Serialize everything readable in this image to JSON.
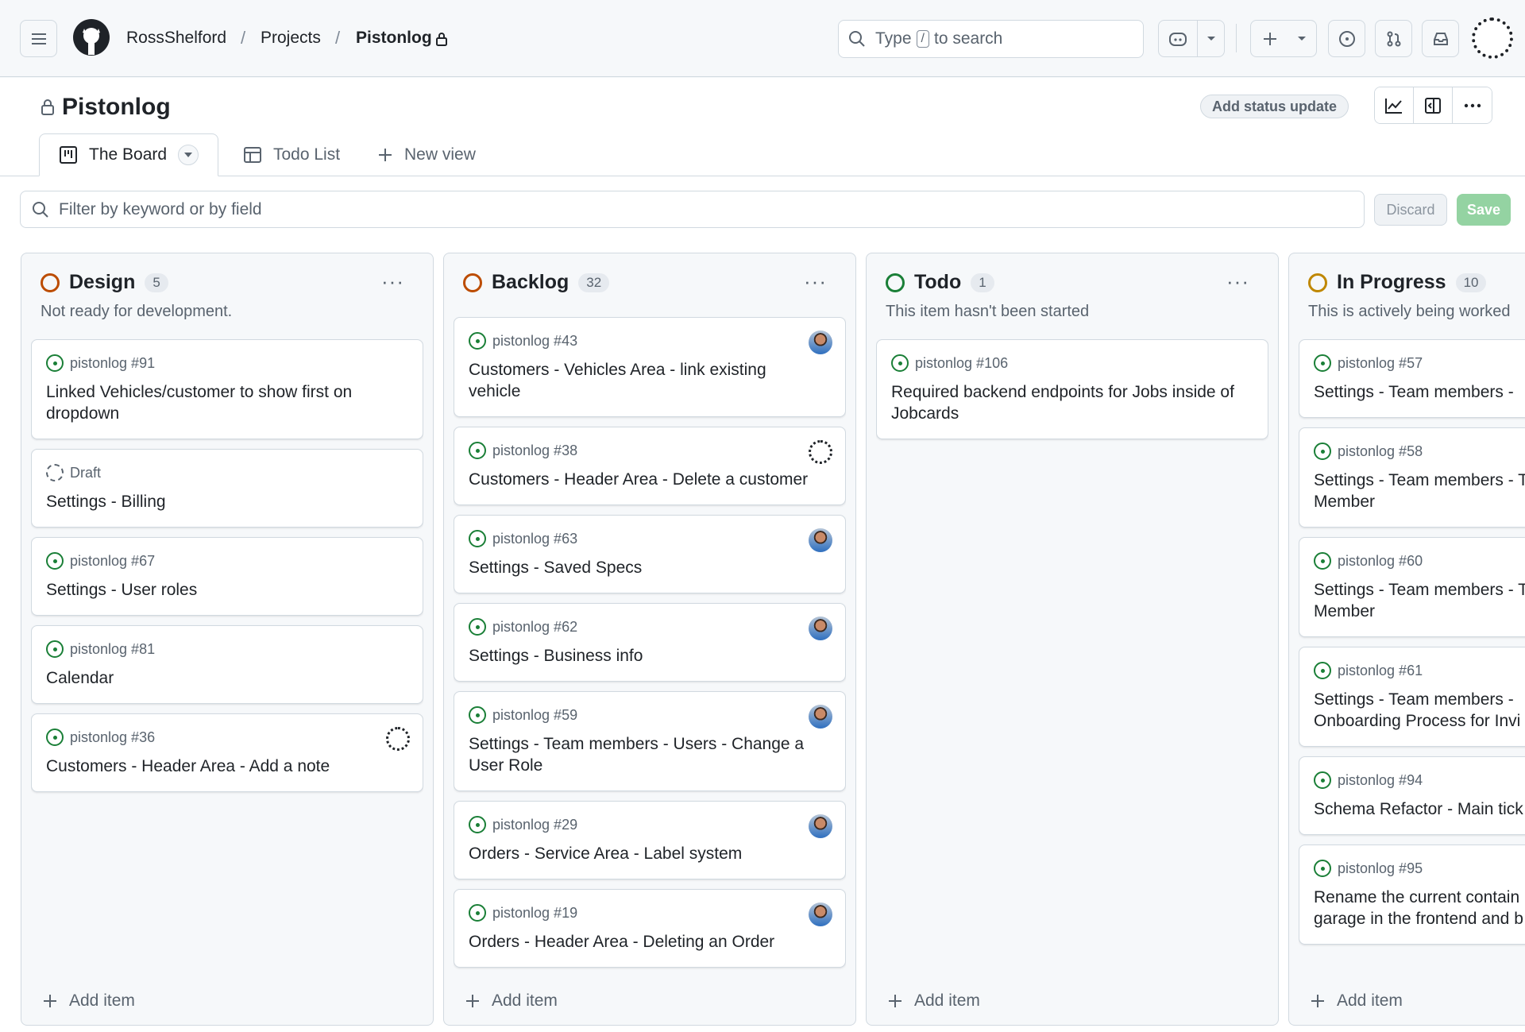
{
  "header": {
    "owner": "RossShelford",
    "projects": "Projects",
    "repo": "Pistonlog",
    "separator": "/",
    "search_prefix": "Type",
    "search_key": "/",
    "search_suffix": "to search"
  },
  "project": {
    "title": "Pistonlog",
    "status_button": "Add status update"
  },
  "tabs": [
    {
      "label": "The Board",
      "active": true
    },
    {
      "label": "Todo List",
      "active": false
    },
    {
      "label": "New view",
      "active": false
    }
  ],
  "filter": {
    "placeholder": "Filter by keyword or by field",
    "discard": "Discard",
    "save": "Save"
  },
  "colors": {
    "green": "#1a7f37",
    "orange": "#bc4c00",
    "yellow": "#bf8700",
    "save_disabled": "#94d3a2"
  },
  "columns": [
    {
      "name": "Design",
      "count": "5",
      "desc": "Not ready for development.",
      "ring": "#bc4c00",
      "add": "Add item",
      "cards": [
        {
          "meta": "pistonlog #91",
          "title": "Linked Vehicles/customer to show first on dropdown",
          "type": "issue",
          "avatar": ""
        },
        {
          "meta": "Draft",
          "title": "Settings - Billing",
          "type": "draft",
          "avatar": ""
        },
        {
          "meta": "pistonlog #67",
          "title": "Settings - User roles",
          "type": "issue",
          "avatar": ""
        },
        {
          "meta": "pistonlog #81",
          "title": "Calendar",
          "type": "issue",
          "avatar": ""
        },
        {
          "meta": "pistonlog #36",
          "title": "Customers - Header Area - Add a note",
          "type": "issue",
          "avatar": "logo"
        }
      ]
    },
    {
      "name": "Backlog",
      "count": "32",
      "desc": "",
      "ring": "#bc4c00",
      "add": "Add item",
      "cards": [
        {
          "meta": "pistonlog #43",
          "title": "Customers - Vehicles Area - link existing vehicle",
          "type": "issue",
          "avatar": "photo"
        },
        {
          "meta": "pistonlog #38",
          "title": "Customers - Header Area - Delete a customer",
          "type": "issue",
          "avatar": "logo"
        },
        {
          "meta": "pistonlog #63",
          "title": "Settings - Saved Specs",
          "type": "issue",
          "avatar": "photo"
        },
        {
          "meta": "pistonlog #62",
          "title": "Settings - Business info",
          "type": "issue",
          "avatar": "photo"
        },
        {
          "meta": "pistonlog #59",
          "title": "Settings - Team members - Users - Change a User Role",
          "type": "issue",
          "avatar": "photo"
        },
        {
          "meta": "pistonlog #29",
          "title": "Orders - Service Area - Label system",
          "type": "issue",
          "avatar": "photo"
        },
        {
          "meta": "pistonlog #19",
          "title": "Orders - Header Area - Deleting an Order",
          "type": "issue",
          "avatar": "photo"
        }
      ]
    },
    {
      "name": "Todo",
      "count": "1",
      "desc": "This item hasn't been started",
      "ring": "#1a7f37",
      "add": "Add item",
      "cards": [
        {
          "meta": "pistonlog #106",
          "title": "Required backend endpoints for Jobs inside of Jobcards",
          "type": "issue",
          "avatar": ""
        }
      ]
    },
    {
      "name": "In Progress",
      "count": "10",
      "desc": "This is actively being worked",
      "ring": "#bf8700",
      "add": "Add item",
      "cards": [
        {
          "meta": "pistonlog #57",
          "title": "Settings - Team members -",
          "type": "issue",
          "avatar": ""
        },
        {
          "meta": "pistonlog #58",
          "title": "Settings - Team members - Team Member",
          "type": "issue",
          "avatar": ""
        },
        {
          "meta": "pistonlog #60",
          "title": "Settings - Team members - Team Member",
          "type": "issue",
          "avatar": ""
        },
        {
          "meta": "pistonlog #61",
          "title": "Settings - Team members - Onboarding Process for Invi",
          "type": "issue",
          "avatar": ""
        },
        {
          "meta": "pistonlog #94",
          "title": "Schema Refactor - Main tick",
          "type": "issue",
          "avatar": ""
        },
        {
          "meta": "pistonlog #95",
          "title": "Rename the current contain garage in the frontend and b",
          "type": "issue",
          "avatar": ""
        }
      ]
    }
  ]
}
